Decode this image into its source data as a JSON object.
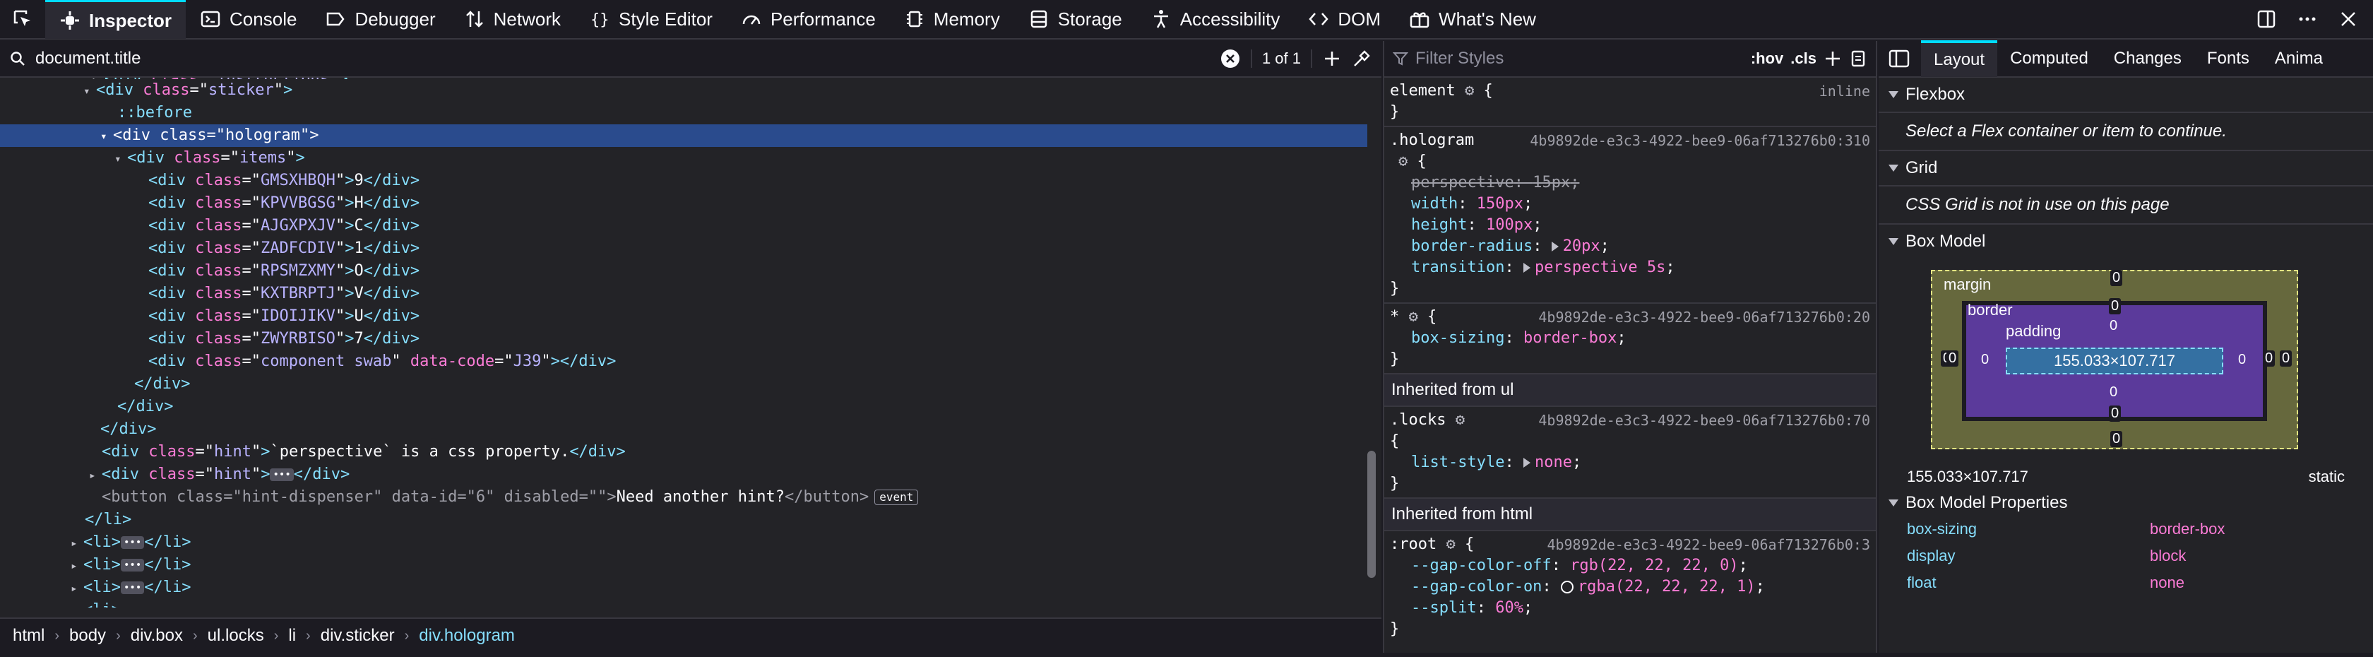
{
  "toolbar": {
    "tabs": [
      {
        "label": "Inspector",
        "icon": "inspector-icon"
      },
      {
        "label": "Console",
        "icon": "console-icon"
      },
      {
        "label": "Debugger",
        "icon": "debugger-icon"
      },
      {
        "label": "Network",
        "icon": "network-icon"
      },
      {
        "label": "Style Editor",
        "icon": "style-editor-icon"
      },
      {
        "label": "Performance",
        "icon": "performance-icon"
      },
      {
        "label": "Memory",
        "icon": "memory-icon"
      },
      {
        "label": "Storage",
        "icon": "storage-icon"
      },
      {
        "label": "Accessibility",
        "icon": "accessibility-icon"
      },
      {
        "label": "DOM",
        "icon": "dom-icon"
      },
      {
        "label": "What's New",
        "icon": "whats-new-icon"
      }
    ]
  },
  "search": {
    "value": "document.title",
    "count": "1 of 1"
  },
  "markup": {
    "l0": {
      "tag": "div",
      "attr": "class",
      "val": "instructions"
    },
    "l1": {
      "tag": "div",
      "attr": "class",
      "val": "sticker"
    },
    "l2": {
      "text": "::before"
    },
    "l3": {
      "tag": "div",
      "attr": "class",
      "val": "hologram"
    },
    "l4": {
      "tag": "div",
      "attr": "class",
      "val": "items"
    },
    "items": [
      {
        "val": "GMSXHBQH",
        "text": "9"
      },
      {
        "val": "KPVVBGSG",
        "text": "H"
      },
      {
        "val": "AJGXPXJV",
        "text": "C"
      },
      {
        "val": "ZADFCDIV",
        "text": "1"
      },
      {
        "val": "RPSMZXMY",
        "text": "O"
      },
      {
        "val": "KXTBRPTJ",
        "text": "V"
      },
      {
        "val": "IDOIJIKV",
        "text": "U"
      },
      {
        "val": "ZWYRBISO",
        "text": "7"
      }
    ],
    "swab": {
      "tag": "div",
      "attr1": "class",
      "val1": "component swab",
      "attr2": "data-code",
      "val2": "J39"
    },
    "hint1": {
      "tag": "div",
      "attr": "class",
      "val": "hint",
      "text": "`perspective` is a css property."
    },
    "hint2": {
      "tag": "div",
      "attr": "class",
      "val": "hint"
    },
    "button": {
      "tag": "button",
      "attr1": "class",
      "val1": "hint-dispenser",
      "attr2": "data-id",
      "val2": "6",
      "attr3": "disabled",
      "val3": "",
      "text": "Need another hint?",
      "badge": "event"
    },
    "li_close": "</li>",
    "li_tag": "li"
  },
  "breadcrumbs": [
    "html",
    "body",
    "div.box",
    "ul.locks",
    "li",
    "div.sticker",
    "div.hologram"
  ],
  "rules": {
    "filter_placeholder": "Filter Styles",
    "hov": ":hov",
    "cls": ".cls",
    "element": {
      "selector": "element",
      "source": "inline"
    },
    "hologram": {
      "selector": ".hologram",
      "source": "4b9892de-e3c3-4922-bee9-06af713276b0:310",
      "decls": [
        {
          "name": "perspective",
          "value": "15px",
          "struck": true
        },
        {
          "name": "width",
          "value": "150px"
        },
        {
          "name": "height",
          "value": "100px"
        },
        {
          "name": "border-radius",
          "value": "20px",
          "expander": true
        },
        {
          "name": "transition",
          "value": "perspective 5s",
          "expander": true
        }
      ]
    },
    "universal": {
      "selector": "*",
      "source": "4b9892de-e3c3-4922-bee9-06af713276b0:20",
      "decls": [
        {
          "name": "box-sizing",
          "value": "border-box"
        }
      ]
    },
    "inherited_ul": "Inherited from ul",
    "locks": {
      "selector": ".locks",
      "source": "4b9892de-e3c3-4922-bee9-06af713276b0:70",
      "decls": [
        {
          "name": "list-style",
          "value": "none",
          "expander": true
        }
      ]
    },
    "inherited_html": "Inherited from html",
    "root": {
      "selector": ":root",
      "source": "4b9892de-e3c3-4922-bee9-06af713276b0:3",
      "decls": [
        {
          "name": "--gap-color-off",
          "value": "rgb(22, 22, 22, 0)"
        },
        {
          "name": "--gap-color-on",
          "value": "rgba(22, 22, 22, 1)",
          "swatch": true
        },
        {
          "name": "--split",
          "value": "60%"
        }
      ]
    }
  },
  "layout": {
    "tabs": [
      "Layout",
      "Computed",
      "Changes",
      "Fonts",
      "Anima"
    ],
    "flexbox": {
      "title": "Flexbox",
      "message": "Select a Flex container or item to continue."
    },
    "grid": {
      "title": "Grid",
      "message": "CSS Grid is not in use on this page"
    },
    "boxmodel": {
      "title": "Box Model",
      "margin_label": "margin",
      "border_label": "border",
      "padding_label": "padding",
      "content": "155.033×107.717",
      "zero": "0",
      "dimensions": "155.033×107.717",
      "position": "static"
    },
    "boxmodel_props": {
      "title": "Box Model Properties",
      "rows": [
        {
          "key": "box-sizing",
          "value": "border-box"
        },
        {
          "key": "display",
          "value": "block"
        },
        {
          "key": "float",
          "value": "none"
        }
      ]
    }
  }
}
